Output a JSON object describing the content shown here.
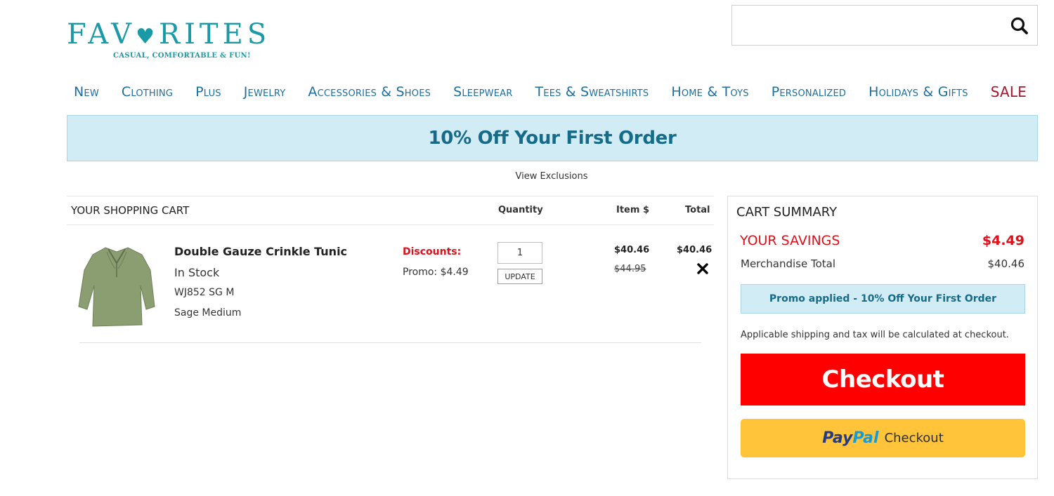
{
  "brand": {
    "name_before": "FAV",
    "name_heart": "♥",
    "name_after": "RITES",
    "tagline": "CASUAL, COMFORTABLE & FUN!",
    "color": "#1a9aa6"
  },
  "search": {
    "placeholder": "",
    "value": "",
    "icon": "search-icon"
  },
  "nav": {
    "items": [
      "New",
      "Clothing",
      "Plus",
      "Jewelry",
      "Accessories & Shoes",
      "Sleepwear",
      "Tees & Sweatshirts",
      "Home & Toys",
      "Personalized",
      "Holidays & Gifts"
    ],
    "sale": "SALE",
    "color": "#1d6f9c",
    "sale_color": "#a7162c"
  },
  "banner": {
    "text": "10% Off Your First Order",
    "exclusions": "View Exclusions"
  },
  "cart": {
    "title": "YOUR SHOPPING CART",
    "columns": {
      "quantity": "Quantity",
      "item_price": "Item $",
      "total": "Total"
    },
    "items": [
      {
        "name": "Double Gauze Crinkle Tunic",
        "stock": "In Stock",
        "sku": "WJ852 SG M",
        "variant": "Sage Medium",
        "discount_label": "Discounts:",
        "discount_promo": "Promo: $4.49",
        "quantity": "1",
        "update_label": "UPDATE",
        "price": "$40.46",
        "original_price": "$44.95",
        "total": "$40.46",
        "image_color": "#8a9e72",
        "remove_icon": "close-icon"
      }
    ]
  },
  "summary": {
    "title": "CART SUMMARY",
    "savings_label": "YOUR SAVINGS",
    "savings_value": "$4.49",
    "merch_label": "Merchandise Total",
    "merch_value": "$40.46",
    "promo_applied": "Promo applied - 10% Off Your First Order",
    "shipping_note": "Applicable shipping and tax will be calculated at checkout.",
    "checkout_label": "Checkout",
    "paypal_pay": "Pay",
    "paypal_pal": "Pal",
    "paypal_checkout": "Checkout",
    "accent_red": "#ff0000",
    "paypal_yellow": "#ffc439"
  }
}
